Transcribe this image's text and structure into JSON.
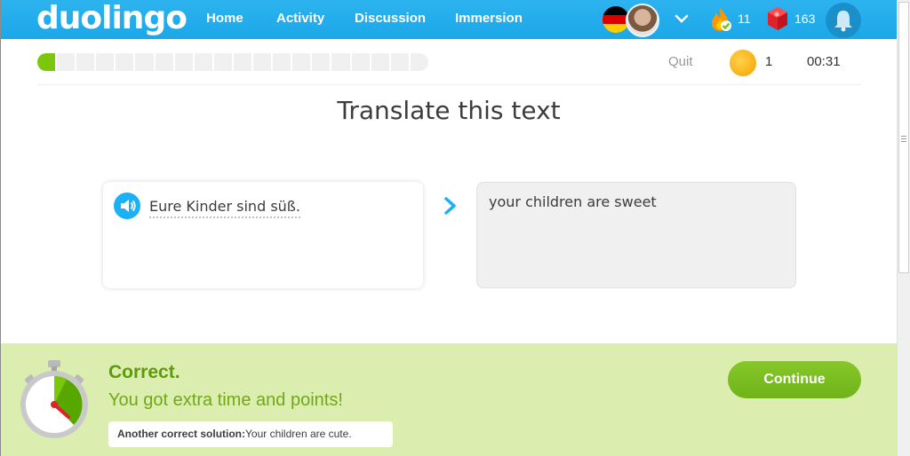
{
  "header": {
    "logo": "duolingo",
    "nav": [
      {
        "label": "Home"
      },
      {
        "label": "Activity"
      },
      {
        "label": "Discussion"
      },
      {
        "label": "Immersion"
      }
    ],
    "streak_count": "11",
    "gems_count": "163",
    "icons": [
      "german-flag-icon",
      "avatar",
      "chevron-down-icon",
      "flame-icon",
      "gem-icon",
      "bell-icon"
    ]
  },
  "lesson": {
    "progress_segments": 20,
    "progress_filled": 1,
    "quit_label": "Quit",
    "coins": "1",
    "timer": "00:31"
  },
  "challenge": {
    "title": "Translate this text",
    "prompt": "Eure Kinder sind süß.",
    "answer": "your children are sweet"
  },
  "result": {
    "title": "Correct.",
    "subtitle": "You got extra time and points!",
    "alt_label": "Another correct solution:",
    "alt_text": "Your children are cute.",
    "continue_label": "Continue"
  },
  "colors": {
    "brand_blue": "#1cb0f6",
    "success_green": "#7ac70c",
    "banner_bg": "#dcedb0"
  }
}
